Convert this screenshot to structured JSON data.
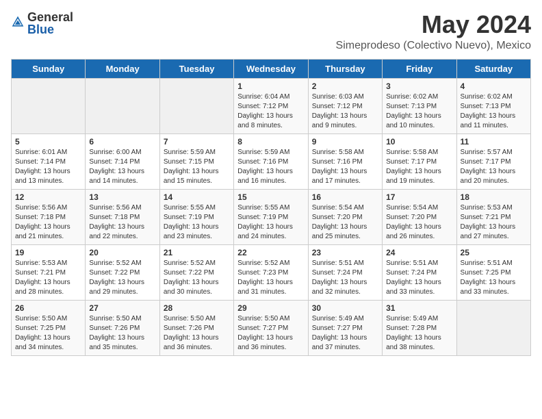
{
  "header": {
    "logo_general": "General",
    "logo_blue": "Blue",
    "title": "May 2024",
    "subtitle": "Simeprodeso (Colectivo Nuevo), Mexico"
  },
  "days_of_week": [
    "Sunday",
    "Monday",
    "Tuesday",
    "Wednesday",
    "Thursday",
    "Friday",
    "Saturday"
  ],
  "weeks": [
    [
      {
        "day": "",
        "info": ""
      },
      {
        "day": "",
        "info": ""
      },
      {
        "day": "",
        "info": ""
      },
      {
        "day": "1",
        "info": "Sunrise: 6:04 AM\nSunset: 7:12 PM\nDaylight: 13 hours\nand 8 minutes."
      },
      {
        "day": "2",
        "info": "Sunrise: 6:03 AM\nSunset: 7:12 PM\nDaylight: 13 hours\nand 9 minutes."
      },
      {
        "day": "3",
        "info": "Sunrise: 6:02 AM\nSunset: 7:13 PM\nDaylight: 13 hours\nand 10 minutes."
      },
      {
        "day": "4",
        "info": "Sunrise: 6:02 AM\nSunset: 7:13 PM\nDaylight: 13 hours\nand 11 minutes."
      }
    ],
    [
      {
        "day": "5",
        "info": "Sunrise: 6:01 AM\nSunset: 7:14 PM\nDaylight: 13 hours\nand 13 minutes."
      },
      {
        "day": "6",
        "info": "Sunrise: 6:00 AM\nSunset: 7:14 PM\nDaylight: 13 hours\nand 14 minutes."
      },
      {
        "day": "7",
        "info": "Sunrise: 5:59 AM\nSunset: 7:15 PM\nDaylight: 13 hours\nand 15 minutes."
      },
      {
        "day": "8",
        "info": "Sunrise: 5:59 AM\nSunset: 7:16 PM\nDaylight: 13 hours\nand 16 minutes."
      },
      {
        "day": "9",
        "info": "Sunrise: 5:58 AM\nSunset: 7:16 PM\nDaylight: 13 hours\nand 17 minutes."
      },
      {
        "day": "10",
        "info": "Sunrise: 5:58 AM\nSunset: 7:17 PM\nDaylight: 13 hours\nand 19 minutes."
      },
      {
        "day": "11",
        "info": "Sunrise: 5:57 AM\nSunset: 7:17 PM\nDaylight: 13 hours\nand 20 minutes."
      }
    ],
    [
      {
        "day": "12",
        "info": "Sunrise: 5:56 AM\nSunset: 7:18 PM\nDaylight: 13 hours\nand 21 minutes."
      },
      {
        "day": "13",
        "info": "Sunrise: 5:56 AM\nSunset: 7:18 PM\nDaylight: 13 hours\nand 22 minutes."
      },
      {
        "day": "14",
        "info": "Sunrise: 5:55 AM\nSunset: 7:19 PM\nDaylight: 13 hours\nand 23 minutes."
      },
      {
        "day": "15",
        "info": "Sunrise: 5:55 AM\nSunset: 7:19 PM\nDaylight: 13 hours\nand 24 minutes."
      },
      {
        "day": "16",
        "info": "Sunrise: 5:54 AM\nSunset: 7:20 PM\nDaylight: 13 hours\nand 25 minutes."
      },
      {
        "day": "17",
        "info": "Sunrise: 5:54 AM\nSunset: 7:20 PM\nDaylight: 13 hours\nand 26 minutes."
      },
      {
        "day": "18",
        "info": "Sunrise: 5:53 AM\nSunset: 7:21 PM\nDaylight: 13 hours\nand 27 minutes."
      }
    ],
    [
      {
        "day": "19",
        "info": "Sunrise: 5:53 AM\nSunset: 7:21 PM\nDaylight: 13 hours\nand 28 minutes."
      },
      {
        "day": "20",
        "info": "Sunrise: 5:52 AM\nSunset: 7:22 PM\nDaylight: 13 hours\nand 29 minutes."
      },
      {
        "day": "21",
        "info": "Sunrise: 5:52 AM\nSunset: 7:22 PM\nDaylight: 13 hours\nand 30 minutes."
      },
      {
        "day": "22",
        "info": "Sunrise: 5:52 AM\nSunset: 7:23 PM\nDaylight: 13 hours\nand 31 minutes."
      },
      {
        "day": "23",
        "info": "Sunrise: 5:51 AM\nSunset: 7:24 PM\nDaylight: 13 hours\nand 32 minutes."
      },
      {
        "day": "24",
        "info": "Sunrise: 5:51 AM\nSunset: 7:24 PM\nDaylight: 13 hours\nand 33 minutes."
      },
      {
        "day": "25",
        "info": "Sunrise: 5:51 AM\nSunset: 7:25 PM\nDaylight: 13 hours\nand 33 minutes."
      }
    ],
    [
      {
        "day": "26",
        "info": "Sunrise: 5:50 AM\nSunset: 7:25 PM\nDaylight: 13 hours\nand 34 minutes."
      },
      {
        "day": "27",
        "info": "Sunrise: 5:50 AM\nSunset: 7:26 PM\nDaylight: 13 hours\nand 35 minutes."
      },
      {
        "day": "28",
        "info": "Sunrise: 5:50 AM\nSunset: 7:26 PM\nDaylight: 13 hours\nand 36 minutes."
      },
      {
        "day": "29",
        "info": "Sunrise: 5:50 AM\nSunset: 7:27 PM\nDaylight: 13 hours\nand 36 minutes."
      },
      {
        "day": "30",
        "info": "Sunrise: 5:49 AM\nSunset: 7:27 PM\nDaylight: 13 hours\nand 37 minutes."
      },
      {
        "day": "31",
        "info": "Sunrise: 5:49 AM\nSunset: 7:28 PM\nDaylight: 13 hours\nand 38 minutes."
      },
      {
        "day": "",
        "info": ""
      }
    ]
  ]
}
